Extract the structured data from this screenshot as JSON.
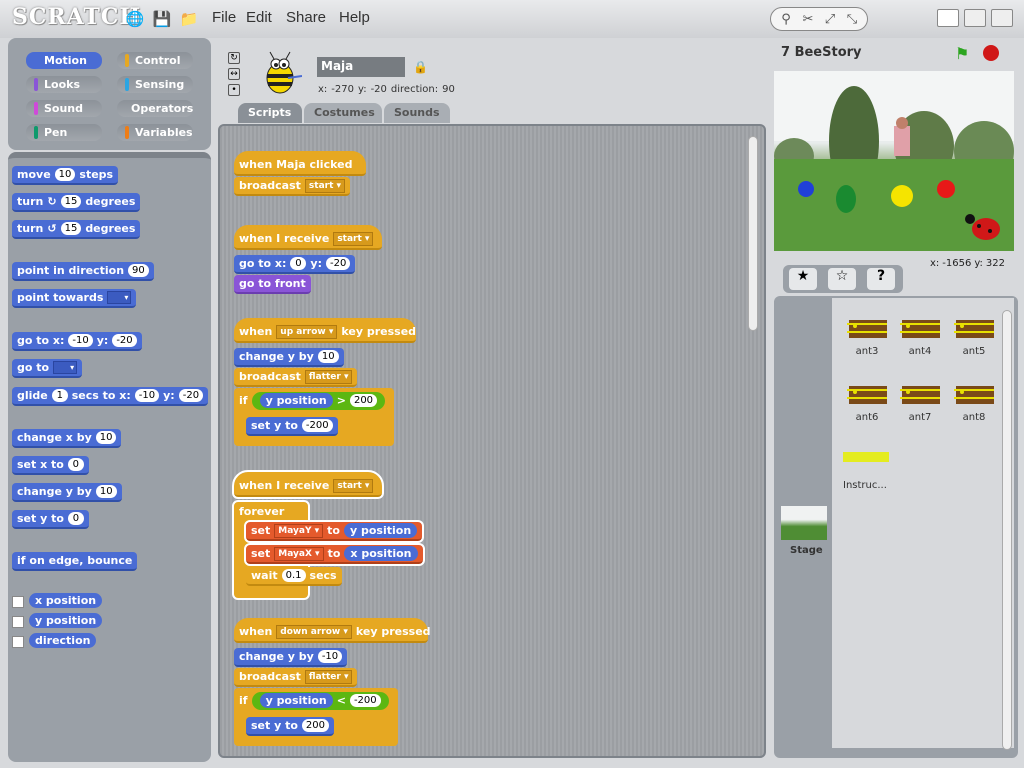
{
  "app": {
    "logo": "SCRATCH"
  },
  "menu": {
    "file": "File",
    "edit": "Edit",
    "share": "Share",
    "help": "Help"
  },
  "categories": [
    {
      "label": "Motion",
      "color": "#4a6cd4"
    },
    {
      "label": "Control",
      "color": "#e6a822"
    },
    {
      "label": "Looks",
      "color": "#8a55d7"
    },
    {
      "label": "Sensing",
      "color": "#2ca5e2"
    },
    {
      "label": "Sound",
      "color": "#cf4ad9"
    },
    {
      "label": "Operators",
      "color": "#5cb712"
    },
    {
      "label": "Pen",
      "color": "#0e9a6c"
    },
    {
      "label": "Variables",
      "color": "#ee7d16"
    }
  ],
  "palette": {
    "move": "move",
    "move_n": "10",
    "steps": "steps",
    "turn": "turn",
    "turn_r_n": "15",
    "degrees": "degrees",
    "turn_l_n": "15",
    "point_dir": "point in direction",
    "point_dir_n": "90",
    "point_towards": "point towards",
    "goto": "go to x:",
    "goto_x": "-10",
    "y": "y:",
    "goto_y": "-20",
    "goto2": "go to",
    "glide": "glide",
    "glide_n": "1",
    "secs_to_x": "secs to x:",
    "glide_x": "-10",
    "glide_y": "-20",
    "change_x": "change x by",
    "change_x_n": "10",
    "set_x": "set x to",
    "set_x_n": "0",
    "change_y": "change y by",
    "change_y_n": "10",
    "set_y": "set y to",
    "set_y_n": "0",
    "bounce": "if on edge, bounce",
    "rep_x": "x position",
    "rep_y": "y position",
    "rep_dir": "direction"
  },
  "sprite": {
    "name": "Maja",
    "x_label": "x:",
    "x": "-270",
    "y_label": "y:",
    "y": "-20",
    "direction_label": "direction:",
    "direction": "90"
  },
  "tabs": {
    "scripts": "Scripts",
    "costumes": "Costumes",
    "sounds": "Sounds"
  },
  "scripts": {
    "s1_hat": "when Maja clicked",
    "broadcast": "broadcast",
    "start": "start",
    "when_receive": "when I receive",
    "goto": "go to x:",
    "goto_x": "0",
    "y": "y:",
    "goto_y": "-20",
    "front": "go to front",
    "when": "when",
    "up_arrow": "up arrow",
    "key_pressed": "key pressed",
    "change_y": "change y by",
    "cy_up": "10",
    "flatter": "flatter",
    "if": "if",
    "y_position": "y position",
    "gt": ">",
    "lim_up": "200",
    "set_y": "set y to",
    "sy_up": "-200",
    "forever": "forever",
    "set": "set",
    "mayay": "MayaY",
    "to": "to",
    "mayax": "MayaX",
    "x_position": "x position",
    "wait": "wait",
    "wait_n": "0.1",
    "secs": "secs",
    "down_arrow": "down arrow",
    "cy_down": "-10",
    "lt": "<",
    "lim_down": "-200",
    "sy_down": "200"
  },
  "stage": {
    "title": "7 BeeStory",
    "mouse_x_label": "x:",
    "mouse_x": "-1656",
    "mouse_y_label": "y:",
    "mouse_y": "322"
  },
  "sprites": [
    "ant3",
    "ant4",
    "ant5",
    "ant6",
    "ant7",
    "ant8",
    "Instruc..."
  ],
  "stage_label": "Stage"
}
